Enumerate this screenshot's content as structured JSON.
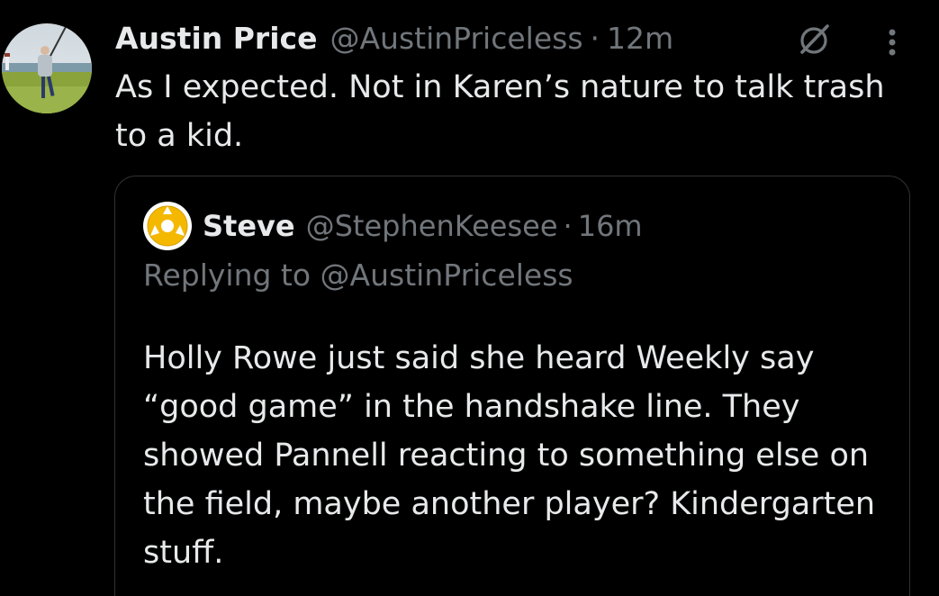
{
  "tweet": {
    "author_name": "Austin Price",
    "author_handle": "@AustinPriceless",
    "separator": "·",
    "time": "12m",
    "text": "As I expected. Not in Karen’s nature to talk trash to a kid.",
    "avatar_icon": "profile-photo-golfer",
    "grok_icon": "grok-icon",
    "more_icon": "more-options-icon"
  },
  "quote": {
    "author_name": "Steve",
    "author_handle": "@StephenKeesee",
    "separator": "·",
    "time": "16m",
    "replying_prefix": "Replying to ",
    "replying_handle": "@AustinPriceless",
    "text": "Holly Rowe just said she heard Weekly say “good game” in the handshake line.  They showed Pannell reacting to something else on the field, maybe another player? Kindergarten stuff.",
    "avatar_icon": "record-45-adapter-icon",
    "avatar_color": "#f5b800"
  },
  "colors": {
    "background": "#000000",
    "primary_text": "#e7e9ea",
    "secondary_text": "#71767b",
    "border": "#2f3336"
  }
}
